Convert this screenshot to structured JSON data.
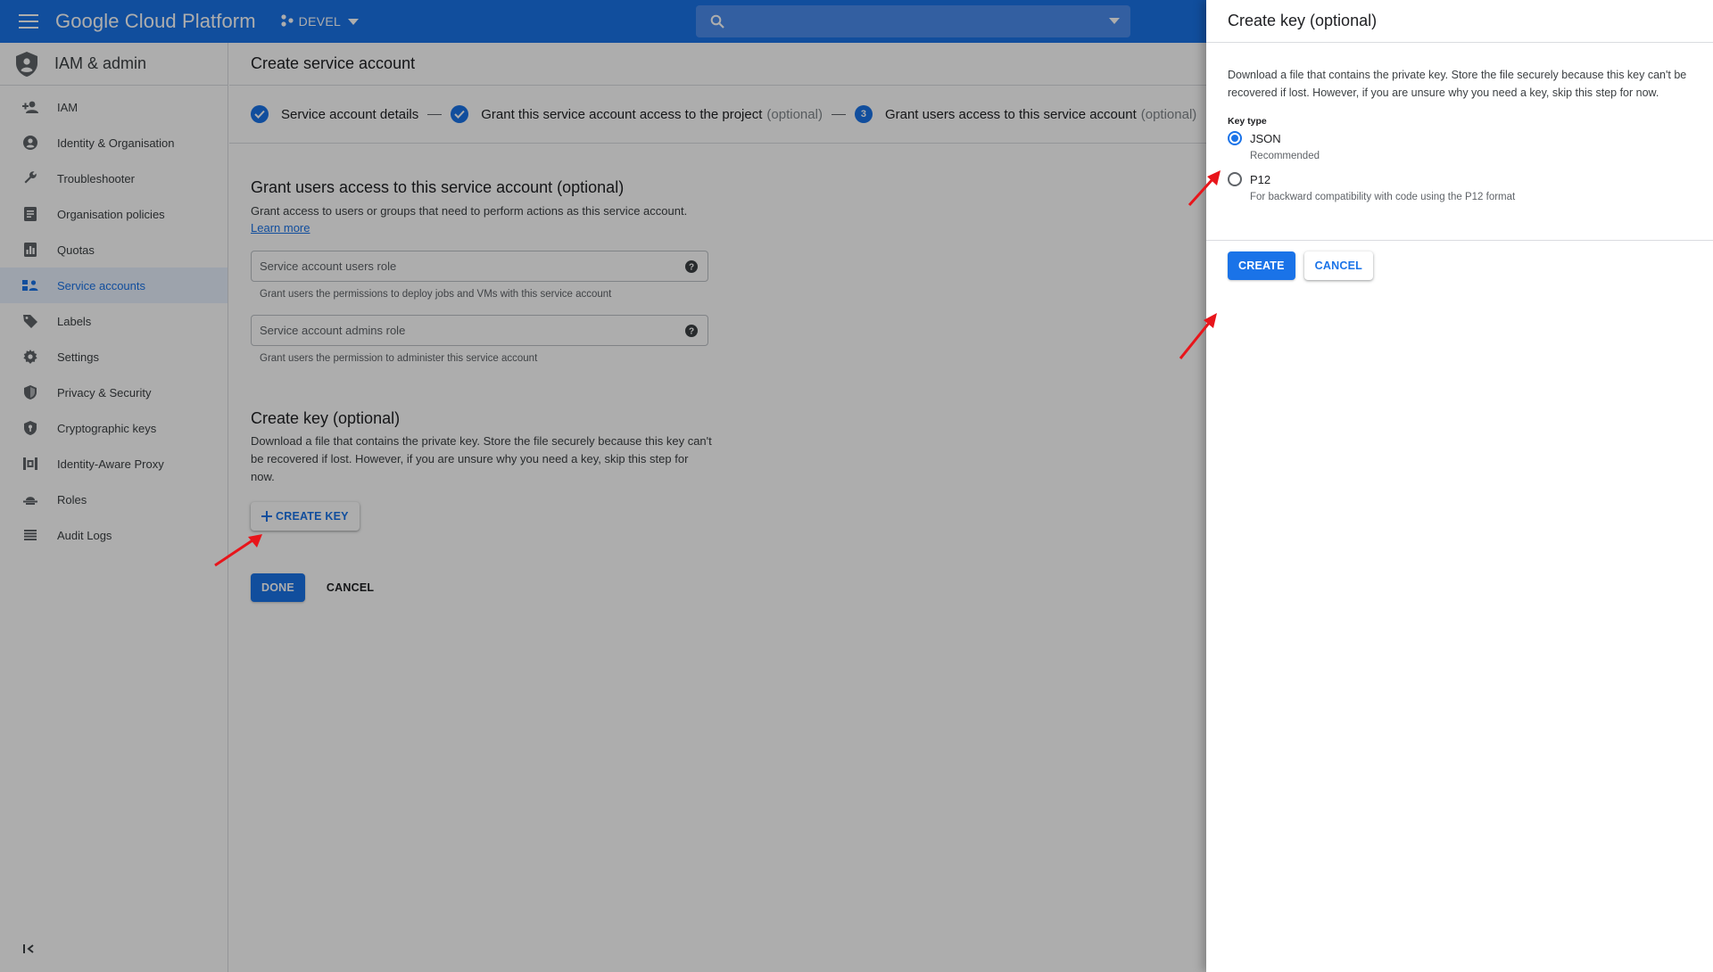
{
  "topbar": {
    "brand": "Google Cloud Platform",
    "project": "DEVEL",
    "search_placeholder": ""
  },
  "sidebar": {
    "title": "IAM & admin",
    "items": [
      {
        "label": "IAM",
        "icon": "person-add-icon"
      },
      {
        "label": "Identity & Organisation",
        "icon": "account-circle-icon"
      },
      {
        "label": "Troubleshooter",
        "icon": "wrench-icon"
      },
      {
        "label": "Organisation policies",
        "icon": "document-icon"
      },
      {
        "label": "Quotas",
        "icon": "quotas-icon"
      },
      {
        "label": "Service accounts",
        "icon": "service-account-icon"
      },
      {
        "label": "Labels",
        "icon": "label-icon"
      },
      {
        "label": "Settings",
        "icon": "settings-icon"
      },
      {
        "label": "Privacy & Security",
        "icon": "shield-icon"
      },
      {
        "label": "Cryptographic keys",
        "icon": "key-shield-icon"
      },
      {
        "label": "Identity-Aware Proxy",
        "icon": "proxy-icon"
      },
      {
        "label": "Roles",
        "icon": "roles-icon"
      },
      {
        "label": "Audit Logs",
        "icon": "list-icon"
      }
    ]
  },
  "main": {
    "page_title": "Create service account",
    "steps": [
      {
        "label": "Service account details",
        "optional": ""
      },
      {
        "label": "Grant this service account access to the project",
        "optional": "(optional)"
      },
      {
        "label": "Grant users access to this service account",
        "optional": "(optional)",
        "number": "3"
      }
    ],
    "grant_section": {
      "title": "Grant users access to this service account (optional)",
      "description": "Grant access to users or groups that need to perform actions as this service account.",
      "learn_more": "Learn more",
      "users_role_placeholder": "Service account users role",
      "users_role_hint": "Grant users the permissions to deploy jobs and VMs with this service account",
      "admins_role_placeholder": "Service account admins role",
      "admins_role_hint": "Grant users the permission to administer this service account"
    },
    "key_section": {
      "title": "Create key (optional)",
      "description": "Download a file that contains the private key. Store the file securely because this key can't be recovered if lost. However, if you are unsure why you need a key, skip this step for now.",
      "create_key_button": "CREATE KEY"
    },
    "done_button": "DONE",
    "cancel_button": "CANCEL"
  },
  "panel": {
    "title": "Create key (optional)",
    "description": "Download a file that contains the private key. Store the file securely because this key can't be recovered if lost. However, if you are unsure why you need a key, skip this step for now.",
    "key_type_label": "Key type",
    "options": [
      {
        "label": "JSON",
        "sub": "Recommended",
        "checked": true
      },
      {
        "label": "P12",
        "sub": "For backward compatibility with code using the P12 format",
        "checked": false
      }
    ],
    "create_button": "CREATE",
    "cancel_button": "CANCEL"
  },
  "colors": {
    "primary": "#1a73e8",
    "annotation_arrow": "#e8151b"
  }
}
